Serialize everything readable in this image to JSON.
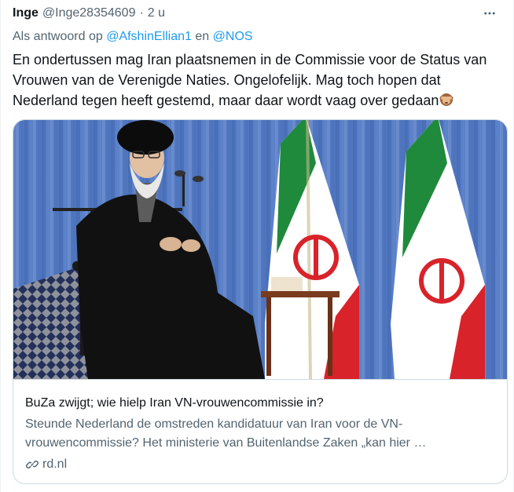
{
  "tweet": {
    "author_name": "Inge",
    "author_handle": "@Inge28354609",
    "separator": "·",
    "time": "2 u",
    "more_icon": "more-horizontal-icon",
    "reply_prefix": "Als antwoord op",
    "reply_user_1": "@AfshinEllian1",
    "reply_conjunction": "en",
    "reply_user_2": "@NOS",
    "text": "En ondertussen mag Iran plaatsnemen in de Commissie voor de Status van Vrouwen van de Verenigde Naties. Ongelofelijk. Mag toch hopen dat Nederland tegen heeft gestemd, maar daar wordt vaag over gedaan",
    "emoji": "see-no-evil-monkey-icon"
  },
  "card": {
    "title": "BuZa zwijgt; wie hielp Iran VN-vrouwencommissie in?",
    "description": "Steunde Nederland de omstreden kandidatuur van Iran voor de VN-vrouwencommissie? Het ministerie van Buitenlandse Zaken „kan hier …",
    "domain": "rd.nl",
    "link_icon": "link-icon"
  },
  "colors": {
    "accent": "#1d9bf0",
    "muted": "#536471",
    "text": "#0f1419",
    "border": "#cfd9de"
  }
}
